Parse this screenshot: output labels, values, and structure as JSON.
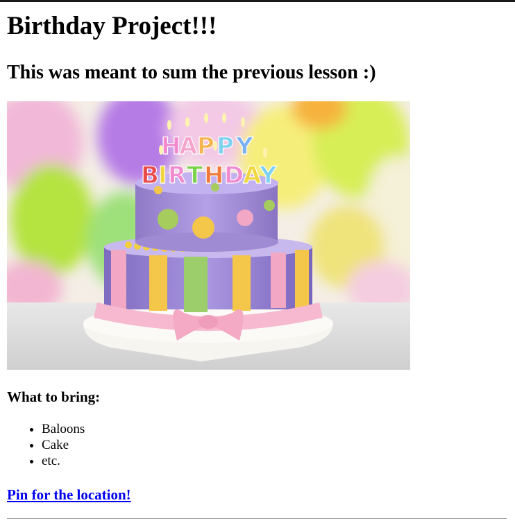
{
  "page": {
    "heading": "Birthday Project!!!",
    "subheading": "This was meant to sum the previous lesson :)",
    "image_caption_text": "HAPPY BIRTHDAY"
  },
  "bring": {
    "title": "What to bring:",
    "items": [
      "Baloons",
      "Cake",
      "etc."
    ]
  },
  "link": {
    "label": "Pin for the location!"
  },
  "colors": {
    "link": "#0000ee",
    "topbar": "#1a1a1a",
    "divider": "#9a9a9a"
  }
}
